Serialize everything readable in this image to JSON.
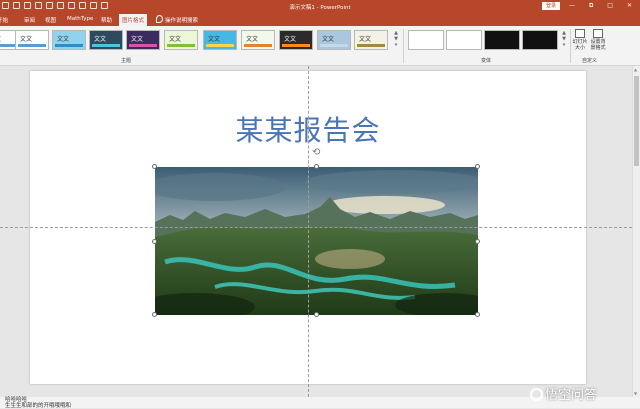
{
  "window": {
    "title": "演示文稿1 - PowerPoint",
    "login_label": "登录",
    "controls": [
      "—",
      "⧉",
      "□",
      "✕"
    ]
  },
  "tabs": [
    {
      "label": "开始"
    },
    {
      "label": "审阅"
    },
    {
      "label": "视图"
    },
    {
      "label": "MathType"
    },
    {
      "label": "帮助"
    },
    {
      "label": "图片格式",
      "active": true
    },
    {
      "label": "操作说明搜索"
    }
  ],
  "ribbon": {
    "style_gallery": [
      {
        "label": "文文",
        "bg": "#ffffff",
        "bar": "#5b9bd5"
      },
      {
        "label": "文文",
        "bg": "#8fd3ef",
        "bar": "#2c8fc7"
      },
      {
        "label": "文文",
        "bg": "#2e4a5f",
        "bar": "#4ec3e0"
      },
      {
        "label": "文文",
        "bg": "#3d2a5e",
        "bar": "#d457a4"
      },
      {
        "label": "文文",
        "bg": "#eaf7d8",
        "bar": "#7fbf3f"
      },
      {
        "label": "文文",
        "bg": "#45b8e6",
        "bar": "#ffd34d"
      },
      {
        "label": "文文",
        "bg": "#f2f8ea",
        "bar": "#e2842f"
      },
      {
        "label": "文文",
        "bg": "#2b2b2b",
        "bar": "#ff8a20"
      },
      {
        "label": "文文",
        "bg": "#a9c8e0",
        "bar": "#c6d9ea"
      },
      {
        "label": "文文",
        "bg": "#f4f1e6",
        "bar": "#a6873f"
      }
    ],
    "variants": [
      {
        "bg": "#ffffff"
      },
      {
        "bg": "#ffffff"
      },
      {
        "bg": "#111111"
      },
      {
        "bg": "#111111"
      }
    ],
    "groups": {
      "theme": "主题",
      "variant": "变体",
      "customize": "自定义"
    },
    "buttons": {
      "slide_size": "幻灯片大小",
      "format_bg": "设置背景格式"
    }
  },
  "slide": {
    "title": "某某报告会"
  },
  "status": {
    "notes_line1": "哈哈哈哈",
    "notes_line2": "生生生和部的的开哦哦哦和"
  },
  "watermark": "悟空问答"
}
